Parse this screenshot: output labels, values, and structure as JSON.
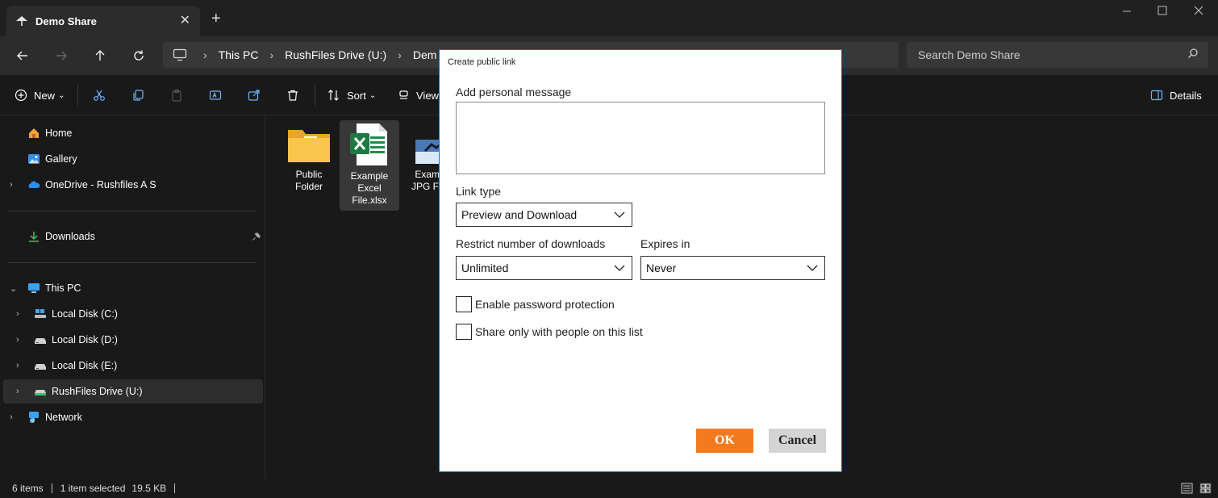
{
  "window": {
    "tab_title": "Demo Share",
    "new_tab": "+",
    "close_tab": "✕"
  },
  "address": {
    "crumbs": [
      "This PC",
      "RushFiles Drive (U:)",
      "Dem"
    ],
    "search_placeholder": "Search Demo Share"
  },
  "commands": {
    "new_label": "New",
    "sort_label": "Sort",
    "view_label": "View",
    "details_label": "Details"
  },
  "sidebar": {
    "items": [
      {
        "label": "Home",
        "icon": "home-icon"
      },
      {
        "label": "Gallery",
        "icon": "gallery-icon"
      },
      {
        "label": "OneDrive - Rushfiles A S",
        "icon": "onedrive-icon"
      },
      {
        "label": "Downloads",
        "icon": "downloads-icon"
      },
      {
        "label": "This PC",
        "icon": "pc-icon"
      },
      {
        "label": "Local Disk (C:)",
        "icon": "drive-icon"
      },
      {
        "label": "Local Disk (D:)",
        "icon": "drive-icon"
      },
      {
        "label": "Local Disk (E:)",
        "icon": "drive-icon"
      },
      {
        "label": "RushFiles Drive (U:)",
        "icon": "rushfiles-drive-icon"
      },
      {
        "label": "Network",
        "icon": "network-icon"
      }
    ]
  },
  "files": [
    {
      "name_line1": "Public",
      "name_line2": "Folder",
      "name_line3": ""
    },
    {
      "name_line1": "Example",
      "name_line2": "Excel",
      "name_line3": "File.xlsx"
    },
    {
      "name_line1": "Examp",
      "name_line2": "JPG File",
      "name_line3": ""
    }
  ],
  "status": {
    "items_count": "6 items",
    "selection": "1 item selected",
    "size": "19.5 KB"
  },
  "dialog": {
    "title": "Create public link",
    "message_label": "Add personal message",
    "message_value": "",
    "link_type_label": "Link type",
    "link_type_value": "Preview and Download",
    "restrict_label": "Restrict number of downloads",
    "restrict_value": "Unlimited",
    "expires_label": "Expires in",
    "expires_value": "Never",
    "password_label": "Enable password protection",
    "password_checked": false,
    "share_list_label": "Share only with people on this list",
    "share_list_checked": false,
    "ok_label": "OK",
    "cancel_label": "Cancel",
    "ok_color": "#f47a20"
  }
}
